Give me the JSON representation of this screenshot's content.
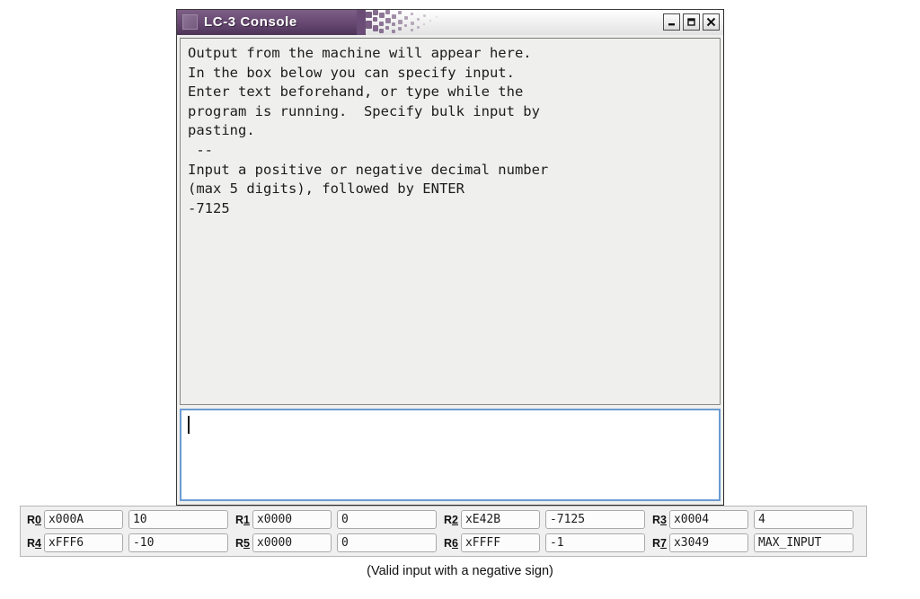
{
  "window": {
    "title": "LC-3 Console",
    "controls": [
      {
        "name": "minimize-button",
        "label": "Minimize"
      },
      {
        "name": "maximize-button",
        "label": "Maximize"
      },
      {
        "name": "close-button",
        "label": "Close"
      }
    ],
    "output_text": "Output from the machine will appear here.\nIn the box below you can specify input.\nEnter text beforehand, or type while the\nprogram is running.  Specify bulk input by\npasting.\n --\nInput a positive or negative decimal number\n(max 5 digits), followed by ENTER\n-7125",
    "input_value": "",
    "input_placeholder": ""
  },
  "registers": {
    "rows": [
      [
        {
          "label_prefix": "R",
          "label_key": "0",
          "hex": "x000A",
          "dec": "10"
        },
        {
          "label_prefix": "R",
          "label_key": "1",
          "hex": "x0000",
          "dec": "0"
        },
        {
          "label_prefix": "R",
          "label_key": "2",
          "hex": "xE42B",
          "dec": "-7125"
        },
        {
          "label_prefix": "R",
          "label_key": "3",
          "hex": "x0004",
          "dec": "4"
        }
      ],
      [
        {
          "label_prefix": "R",
          "label_key": "4",
          "hex": "xFFF6",
          "dec": "-10"
        },
        {
          "label_prefix": "R",
          "label_key": "5",
          "hex": "x0000",
          "dec": "0"
        },
        {
          "label_prefix": "R",
          "label_key": "6",
          "hex": "xFFFF",
          "dec": "-1"
        },
        {
          "label_prefix": "R",
          "label_key": "7",
          "hex": "x3049",
          "dec": "MAX_INPUT"
        }
      ]
    ]
  },
  "caption": "(Valid input with a negative sign)",
  "colors": {
    "title_purple": "#6e4f78",
    "input_border_blue": "#6a9bd1",
    "console_bg": "#efefed",
    "panel_bg": "#f0f0f0"
  }
}
